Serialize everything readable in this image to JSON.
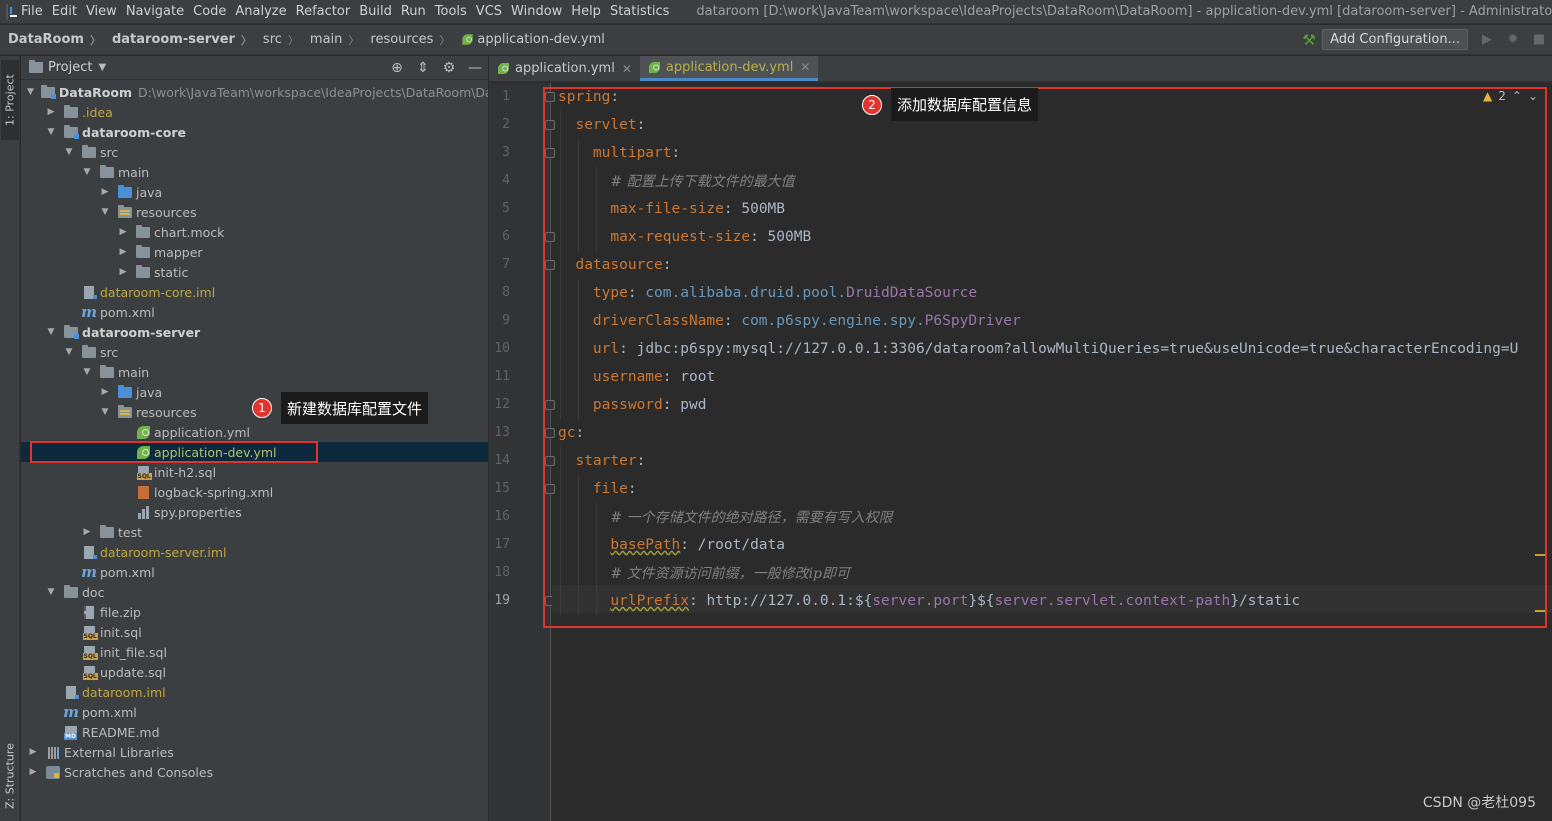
{
  "menu": [
    "File",
    "Edit",
    "View",
    "Navigate",
    "Code",
    "Analyze",
    "Refactor",
    "Build",
    "Run",
    "Tools",
    "VCS",
    "Window",
    "Help",
    "Statistics"
  ],
  "window_title": "dataroom [D:\\work\\JavaTeam\\workspace\\IdeaProjects\\DataRoom\\DataRoom] - application-dev.yml [dataroom-server] - Administrator",
  "breadcrumb": [
    "DataRoom",
    "dataroom-server",
    "src",
    "main",
    "resources",
    "application-dev.yml"
  ],
  "toolbar": {
    "add_config": "Add Configuration..."
  },
  "side_tabs": {
    "project": "1: Project",
    "structure": "Z: Structure"
  },
  "project_panel": {
    "title": "Project"
  },
  "tree": {
    "root": "DataRoom",
    "root_path": "D:\\work\\JavaTeam\\workspace\\IdeaProjects\\DataRoom\\DataR",
    "idea": ".idea",
    "core": "dataroom-core",
    "core_src": "src",
    "core_main": "main",
    "core_java": "java",
    "core_resources": "resources",
    "core_chartmock": "chart.mock",
    "core_mapper": "mapper",
    "core_static": "static",
    "core_iml": "dataroom-core.iml",
    "core_pom": "pom.xml",
    "server": "dataroom-server",
    "server_src": "src",
    "server_main": "main",
    "server_java": "java",
    "server_resources": "resources",
    "app_yml": "application.yml",
    "app_dev_yml": "application-dev.yml",
    "init_h2": "init-h2.sql",
    "logback": "logback-spring.xml",
    "spy": "spy.properties",
    "server_test": "test",
    "server_iml": "dataroom-server.iml",
    "server_pom": "pom.xml",
    "doc": "doc",
    "file_zip": "file.zip",
    "init_sql": "init.sql",
    "init_file_sql": "init_file.sql",
    "update_sql": "update.sql",
    "dataroom_iml": "dataroom.iml",
    "root_pom": "pom.xml",
    "readme": "README.md",
    "ext_libs": "External Libraries",
    "scratches": "Scratches and Consoles"
  },
  "editor_tabs": [
    "application.yml",
    "application-dev.yml"
  ],
  "inspection": {
    "warnings": "2"
  },
  "annotations": {
    "one": {
      "num": "1",
      "text": "新建数据库配置文件"
    },
    "two": {
      "num": "2",
      "text": "添加数据库配置信息"
    }
  },
  "code": {
    "l1": "spring",
    "l2": "servlet",
    "l3": "multipart",
    "l4": "# 配置上传下载文件的最大值",
    "l5k": "max-file-size",
    "l5v": "500MB",
    "l6k": "max-request-size",
    "l6v": "500MB",
    "l7": "datasource",
    "l8k": "type",
    "l8p": "com.alibaba.druid.pool.",
    "l8c": "DruidDataSource",
    "l9k": "driverClassName",
    "l9p": "com.p6spy.engine.spy.",
    "l9c": "P6SpyDriver",
    "l10k": "url",
    "l10v": "jdbc:p6spy:mysql://127.0.0.1:3306/dataroom?allowMultiQueries=true&useUnicode=true&characterEncoding=U",
    "l11k": "username",
    "l11v": "root",
    "l12k": "password",
    "l12v": "pwd",
    "l13": "gc",
    "l14": "starter",
    "l15": "file",
    "l16": "# 一个存储文件的绝对路径，需要有写入权限",
    "l17k": "basePath",
    "l17v": "/root/data",
    "l18": "# 文件资源访问前缀，一般修改ip即可",
    "l19k": "urlPrefix",
    "l19a": "http://127.0.0.1:",
    "l19r1": "server.port",
    "l19r2": "server.servlet.context-path",
    "l19b": "/static"
  },
  "watermark": "CSDN @老杜095"
}
